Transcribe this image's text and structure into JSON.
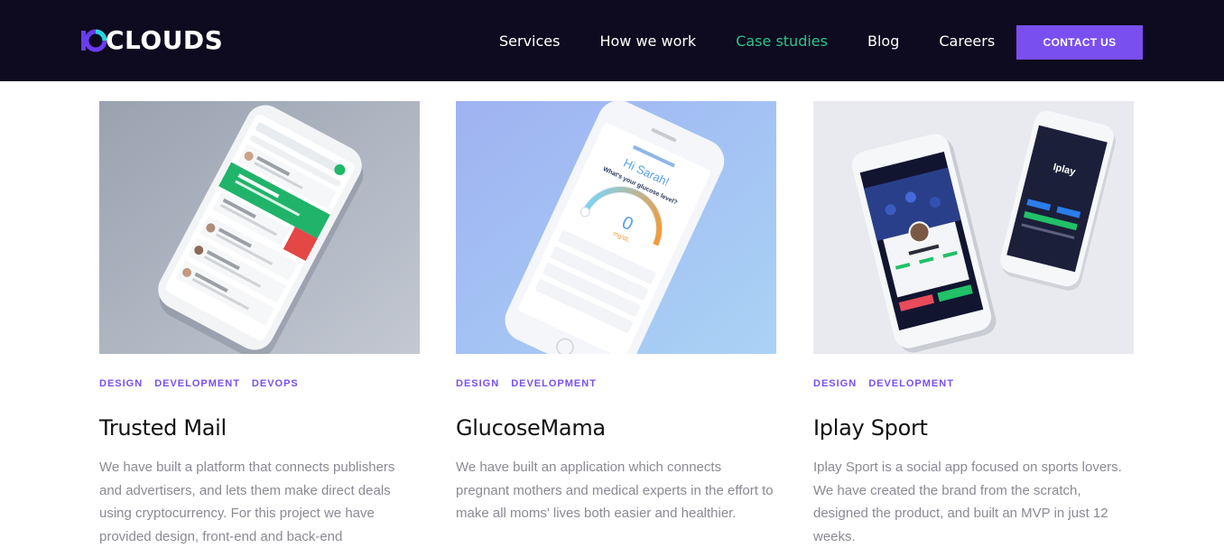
{
  "header": {
    "logo_text": "CLOUDS",
    "logo_alt": "10Clouds",
    "nav": [
      {
        "label": "Services",
        "active": false
      },
      {
        "label": "How we work",
        "active": false
      },
      {
        "label": "Case studies",
        "active": true
      },
      {
        "label": "Blog",
        "active": false
      },
      {
        "label": "Careers",
        "active": false
      }
    ],
    "contact_label": "CONTACT US"
  },
  "colors": {
    "header_bg": "#0e0a1f",
    "accent": "#7a4ff0",
    "active_nav": "#2bc48a",
    "text_muted": "#8a8a95"
  },
  "cards": [
    {
      "tags": [
        "DESIGN",
        "DEVELOPMENT",
        "DEVOPS"
      ],
      "title": "Trusted Mail",
      "description": "We have built a platform that connects publishers and advertisers, and lets them make direct deals using cryptocurrency. For this project we have provided design, front-end and back-end",
      "image_icon": "phone-mail-app-mockup"
    },
    {
      "tags": [
        "DESIGN",
        "DEVELOPMENT"
      ],
      "title": "GlucoseMama",
      "description": "We have built an application which connects pregnant mothers and medical experts in the effort to make all moms' lives both easier and healthier.",
      "image_icon": "phone-glucose-app-mockup",
      "screen": {
        "greeting": "Hi Sarah!",
        "question": "What's your glucose level?",
        "reading": "0",
        "unit": "mg/dL"
      }
    },
    {
      "tags": [
        "DESIGN",
        "DEVELOPMENT"
      ],
      "title": "Iplay Sport",
      "description": "Iplay Sport is a social app focused on sports lovers. We have created the brand from the scratch, designed the product, and built an MVP in just 12 weeks.",
      "image_icon": "phones-sport-app-mockup",
      "screen": {
        "brand": "Iplay"
      }
    }
  ]
}
